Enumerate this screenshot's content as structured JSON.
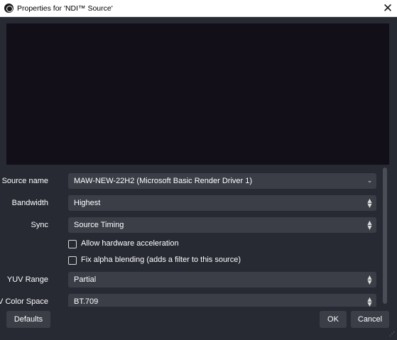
{
  "window": {
    "title": "Properties for 'NDI™ Source'",
    "close_glyph": "✕"
  },
  "form": {
    "source_name": {
      "label": "Source name",
      "value": "MAW-NEW-22H2 (Microsoft Basic Render Driver 1)"
    },
    "bandwidth": {
      "label": "Bandwidth",
      "value": "Highest"
    },
    "sync": {
      "label": "Sync",
      "value": "Source Timing"
    },
    "allow_hw_accel": {
      "label": "Allow hardware acceleration",
      "checked": false
    },
    "fix_alpha": {
      "label": "Fix alpha blending (adds a filter to this source)",
      "checked": false
    },
    "yuv_range": {
      "label": "YUV Range",
      "value": "Partial"
    },
    "yuv_color_space": {
      "label": "YUV Color Space",
      "value": "BT.709"
    }
  },
  "buttons": {
    "defaults": "Defaults",
    "ok": "OK",
    "cancel": "Cancel"
  },
  "icons": {
    "app": "obs-logo-icon",
    "close": "close-icon",
    "dropdown": "chevron-down-icon",
    "spin": "updown-arrows-icon",
    "grip": "resize-grip-icon"
  },
  "colors": {
    "window_bg": "#272a33",
    "field_bg": "#3b3e47",
    "preview_bg": "#120f19",
    "titlebar_bg": "#ffffff"
  }
}
